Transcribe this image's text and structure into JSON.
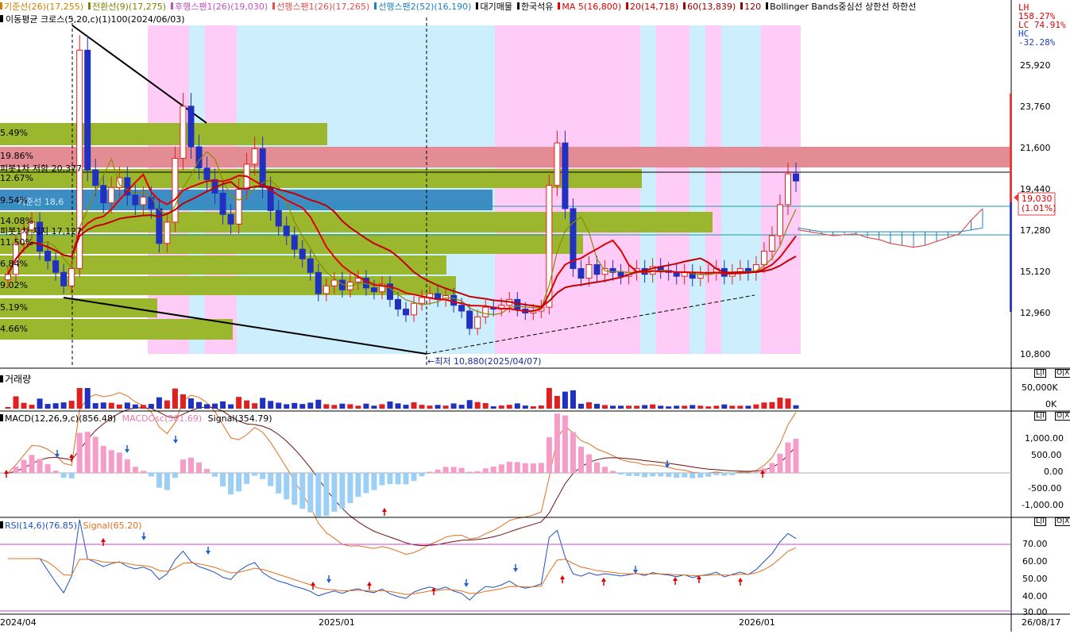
{
  "header": {
    "items": [
      {
        "label": "기준선(26)(17,255)",
        "color": "#d08000"
      },
      {
        "label": "전환선(9)(17,275)",
        "color": "#808000"
      },
      {
        "label": "후행스팬1(26)(19,030)",
        "color": "#c050c0"
      },
      {
        "label": "선행스팬1(26)(17,265)",
        "color": "#e05050"
      },
      {
        "label": "선행스팬2(52)(16,190)",
        "color": "#2080c0"
      },
      {
        "label": "대기매물",
        "color": "#000000"
      },
      {
        "label": "한국석유",
        "color": "#000000"
      },
      {
        "label": "MA 5(16,800)",
        "color": "#e00000"
      },
      {
        "label": "20(14,718)",
        "color": "#c00000"
      },
      {
        "label": "60(13,839)",
        "color": "#a00000"
      },
      {
        "label": "120",
        "color": "#800000"
      },
      {
        "label": "Bollinger Bands중심선 상한선 하한선",
        "color": "#000000"
      }
    ],
    "line2": "이동평균 크로스(5,20,c)(1)100(2024/06/03)",
    "stats": [
      "LH 158.27%",
      "LC 74.91%",
      "HC -32.28%"
    ]
  },
  "price_panel": {
    "y_ticks": [
      "25,920",
      "23,760",
      "21,600",
      "19,440",
      "17,280",
      "15,120",
      "12,960",
      "10,800"
    ],
    "current_price": "19,030",
    "current_change": "(1.01%)",
    "fib_labels": [
      "피봇1차 저항 20,377",
      "기준선 18,6",
      "피봇1차 지지 17,127"
    ],
    "pct_labels": [
      "5.49%",
      "19.86%",
      "12.67%",
      "9.54%",
      "14.08%",
      "11.50%",
      "6.84%",
      "9.02%",
      "5.19%",
      "4.66%"
    ],
    "low_label": "최저 10,880(2025/04/07)"
  },
  "volume_panel": {
    "title": "거래량",
    "y_ticks": [
      "50,000K",
      "0K"
    ]
  },
  "macd_panel": {
    "title_macd": "MACD(12,26,9,c)(856.48)",
    "title_osc": "MACDOsc(501.69)",
    "title_signal": "Signal(354.79)",
    "y_ticks": [
      "1,000.00",
      "500.00",
      "0.00",
      "-500.00",
      "-1,000.00"
    ]
  },
  "rsi_panel": {
    "title_rsi": "RSI(14,6)(76.85)",
    "title_signal": "Signal(65.20)",
    "y_ticks": [
      "70.00",
      "60.00",
      "50.00",
      "40.00",
      "30.00"
    ]
  },
  "x_axis": {
    "labels": [
      "2024/04",
      "2025/01",
      "2026/01",
      "26/08/17"
    ]
  },
  "panel_buttons": {
    "lock": "L|I",
    "close": "O|X"
  },
  "chart_data": {
    "type": "candlestick",
    "title": "한국석유",
    "y_range": [
      10000,
      27000
    ],
    "last_close": 19030,
    "low": {
      "value": 10880,
      "date": "2025/04/07"
    },
    "moving_averages": {
      "MA5": 16800,
      "MA20": 14718,
      "MA60": 13839
    },
    "ichimoku": {
      "기준선": 17255,
      "전환선": 17275,
      "후행스팬1": 19030,
      "선행스팬1": 17265,
      "선행스팬2": 16190
    },
    "macd": {
      "macd": 856.48,
      "osc": 501.69,
      "signal": 354.79,
      "y_range": [
        -1250,
        1250
      ]
    },
    "rsi": {
      "rsi": 76.85,
      "signal": 65.2,
      "y_range": [
        25,
        85
      ]
    },
    "x_labels": [
      "2024/04",
      "2025/01",
      "2026/01"
    ],
    "closes": [
      14200,
      15800,
      16500,
      16900,
      15400,
      14900,
      14300,
      13600,
      14500,
      25800,
      19600,
      18800,
      17900,
      18700,
      19200,
      18300,
      17800,
      18200,
      17600,
      15800,
      16900,
      20200,
      22900,
      20800,
      19700,
      19100,
      18400,
      17300,
      16800,
      18600,
      19900,
      20700,
      18700,
      17500,
      16700,
      16200,
      15500,
      15000,
      14300,
      13200,
      13600,
      13900,
      13400,
      13800,
      14000,
      13500,
      13300,
      13700,
      12900,
      12400,
      12100,
      12700,
      13000,
      13200,
      12900,
      13100,
      12600,
      12300,
      11400,
      12000,
      12500,
      12400,
      12600,
      12900,
      12400,
      12200,
      12300,
      12500,
      18800,
      21000,
      17600,
      14500,
      14000,
      14700,
      14200,
      14500,
      14300,
      14100,
      14300,
      14500,
      14200,
      14600,
      14400,
      14300,
      14100,
      14300,
      14000,
      14200,
      14300,
      14500,
      14100,
      14300,
      14500,
      14300,
      14700,
      15400,
      16200,
      17800,
      19400,
      19030
    ]
  }
}
